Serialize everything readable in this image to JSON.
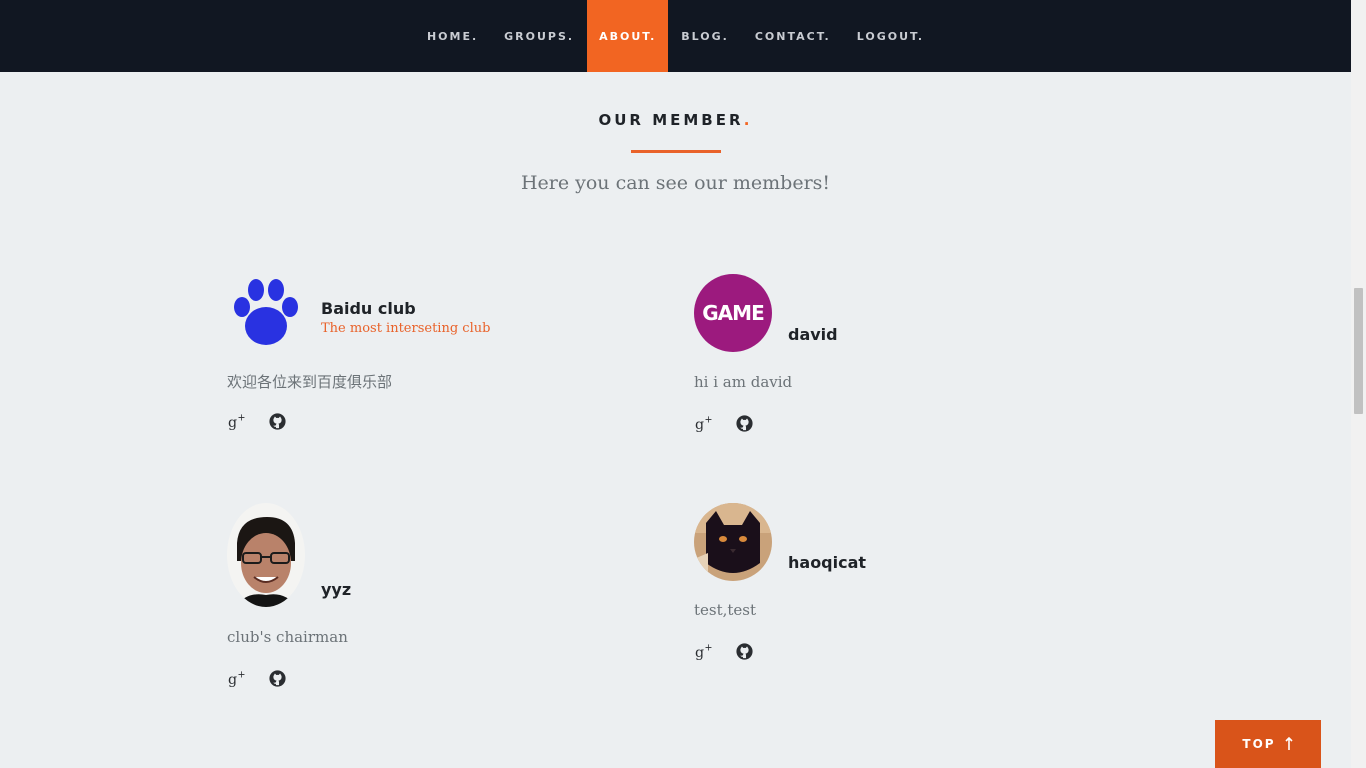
{
  "nav": {
    "items": [
      {
        "label": "HOME."
      },
      {
        "label": "GROUPS."
      },
      {
        "label": "ABOUT.",
        "active": true
      },
      {
        "label": "BLOG."
      },
      {
        "label": "CONTACT."
      },
      {
        "label": "LOGOUT."
      }
    ]
  },
  "section": {
    "title": "OUR MEMBER",
    "title_dot": ".",
    "subtitle": "Here you can see our members!"
  },
  "members": [
    {
      "name": "Baidu club",
      "tagline": "The most interseting club",
      "bio": "欢迎各位来到百度俱乐部",
      "avatar_icon": "paw-icon",
      "avatar_color": "#2932e1"
    },
    {
      "name": "david",
      "bio": "hi i am david",
      "avatar_text": "GAME",
      "avatar_color": "#9c1a7e"
    },
    {
      "name": "yyz",
      "bio": "club's chairman",
      "avatar_icon": "person-photo"
    },
    {
      "name": "haoqicat",
      "bio": "test,test",
      "avatar_icon": "cat-photo"
    }
  ],
  "top_button": {
    "label": "TOP",
    "icon": "arrow-up-icon"
  },
  "colors": {
    "accent": "#f26522",
    "navbar": "#111722",
    "background": "#eceff1"
  }
}
